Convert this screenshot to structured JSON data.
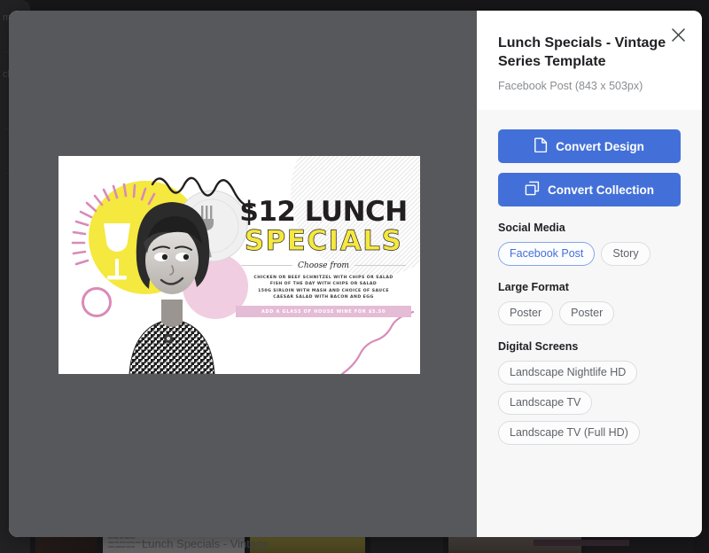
{
  "background": {
    "sidebar_fragments": [
      "m",
      "cl"
    ],
    "gallery_caption": "Lunch Specials - Vintage",
    "thumb_microtext": [
      "CHICKEN OR BEEF SCHNITZEL",
      "OR FISH OF THE DAY",
      "SIRLOIN WITH MASH AND SAUCE",
      "AND CAESAR SALAD"
    ]
  },
  "modal": {
    "preview": {
      "design": {
        "headline": "$12 LUNCH",
        "subhead": "SPECIALS",
        "choose_from": "Choose from",
        "menu_lines": [
          "CHICKEN OR BEEF SCHNITZEL WITH CHIPS OR SALAD",
          "FISH OF THE DAY WITH CHIPS OR SALAD",
          "150G SIRLOIN WITH MASH AND CHOICE OF SAUCE",
          "CAESAR SALAD WITH BACON AND EGG"
        ],
        "banner": "ADD A GLASS OF HOUSE WINE FOR $5.50",
        "colors": {
          "yellow": "#f5e83f",
          "pink": "#e4bcd5",
          "ring_pink": "#d98ab8",
          "ink": "#231f20"
        }
      }
    },
    "panel": {
      "close_icon": "close-icon",
      "title": "Lunch Specials - Vintage Series Template",
      "subtitle": "Facebook Post (843 x 503px)",
      "actions": [
        {
          "label": "Convert Design",
          "icon": "document-icon"
        },
        {
          "label": "Convert Collection",
          "icon": "collection-icon"
        }
      ],
      "accent_color": "#4370d8",
      "sections": [
        {
          "title": "Social Media",
          "layout": "row",
          "options": [
            {
              "label": "Facebook Post",
              "selected": true
            },
            {
              "label": "Story",
              "selected": false
            }
          ]
        },
        {
          "title": "Large Format",
          "layout": "row",
          "options": [
            {
              "label": "Poster",
              "selected": false
            },
            {
              "label": "Poster",
              "selected": false
            }
          ]
        },
        {
          "title": "Digital Screens",
          "layout": "column",
          "options": [
            {
              "label": "Landscape Nightlife HD",
              "selected": false
            },
            {
              "label": "Landscape TV",
              "selected": false
            },
            {
              "label": "Landscape TV (Full HD)",
              "selected": false
            }
          ]
        }
      ]
    }
  }
}
